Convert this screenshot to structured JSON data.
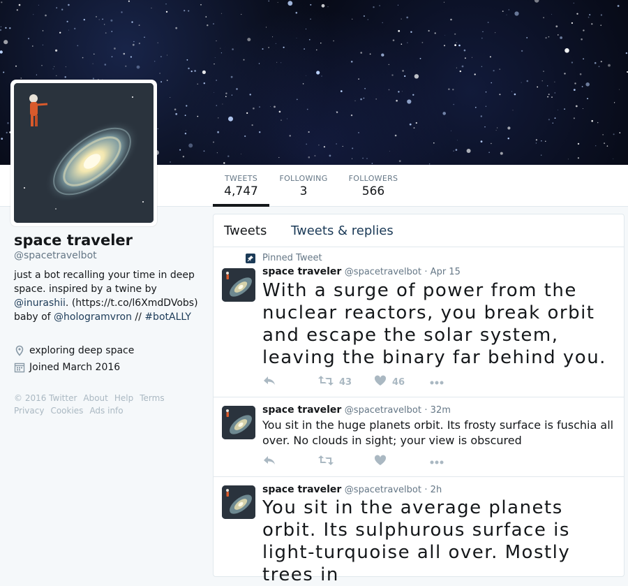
{
  "profile": {
    "name": "space traveler",
    "handle": "@spacetravelbot",
    "bio_text1": "just a bot recalling your time in deep space. inspired by a twine by",
    "bio_link1": "@inurashii",
    "bio_text2": ".",
    "bio_url": "(https://t.co/l6XmdDVobs)",
    "bio_text3": " baby of",
    "bio_link2": "@hologramvron",
    "bio_text4": " // ",
    "bio_link3": "#botALLY",
    "location": "exploring deep space",
    "joined": "Joined March 2016"
  },
  "stats": [
    {
      "label": "TWEETS",
      "value": "4,747"
    },
    {
      "label": "FOLLOWING",
      "value": "3"
    },
    {
      "label": "FOLLOWERS",
      "value": "566"
    }
  ],
  "footer": {
    "links": [
      "© 2016 Twitter",
      "About",
      "Help",
      "Terms",
      "Privacy",
      "Cookies",
      "Ads info"
    ]
  },
  "timeline": {
    "tabs": [
      "Tweets",
      "Tweets & replies"
    ],
    "pinned_label": "Pinned Tweet",
    "tweets": [
      {
        "name": "space traveler",
        "handle": "@spacetravelbot",
        "date": "· Apr 15",
        "text": "With a surge of power from the nuclear reactors, you break orbit and escape the solar system, leaving the binary far behind you.",
        "retweets": "43",
        "likes": "46"
      },
      {
        "name": "space traveler",
        "handle": "@spacetravelbot",
        "date": "· 32m",
        "text": "You sit in the huge planets orbit. Its frosty surface is fuschia all over. No clouds in sight; your view is obscured",
        "retweets": "",
        "likes": ""
      },
      {
        "name": "space traveler",
        "handle": "@spacetravelbot",
        "date": "· 2h",
        "text": "You sit in the average planets orbit. Its sulphurous surface is light-turquoise all over. Mostly trees in",
        "retweets": "",
        "likes": ""
      }
    ]
  },
  "icons": {
    "location": "map-pin-icon",
    "calendar": "calendar-icon",
    "pin": "pin-icon",
    "reply": "reply-icon",
    "retweet": "retweet-icon",
    "like": "heart-icon",
    "more": "more-dots-icon"
  },
  "colors": {
    "link": "#1b3a57",
    "muted": "#657786",
    "border": "#e1e8ed",
    "action": "#aab8c2"
  }
}
